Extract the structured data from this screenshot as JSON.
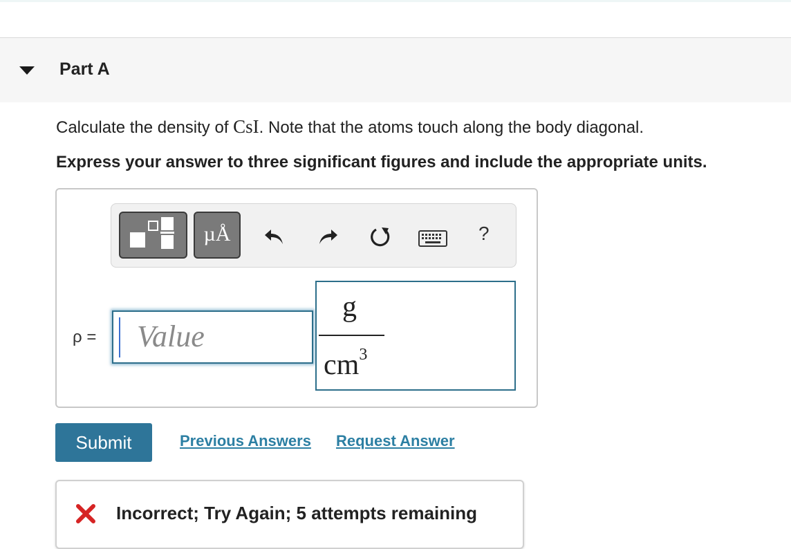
{
  "part": {
    "title": "Part A"
  },
  "question": {
    "prefix": "Calculate the density of ",
    "formula": "CsI",
    "suffix": ". Note that the atoms touch along the body diagonal.",
    "instruction": "Express your answer to three significant figures and include the appropriate units."
  },
  "toolbar": {
    "templates": "templates",
    "units": "µÅ",
    "undo": "undo",
    "redo": "redo",
    "reset": "reset",
    "keyboard": "keyboard",
    "help": "?"
  },
  "answer": {
    "variable_label": "ρ =",
    "value_placeholder": "Value",
    "value": "",
    "unit_numerator": "g",
    "unit_denominator": "cm",
    "unit_exponent": "3"
  },
  "actions": {
    "submit": "Submit",
    "previous_answers": "Previous Answers",
    "request_answer": "Request Answer"
  },
  "feedback": {
    "message": "Incorrect; Try Again; 5 attempts remaining"
  },
  "icons": {
    "collapse": "caret-down-icon",
    "undo": "undo-icon",
    "redo": "redo-icon",
    "reset": "reset-icon",
    "keyboard": "keyboard-icon",
    "help": "help-icon",
    "incorrect": "x-icon"
  },
  "colors": {
    "accent": "#2e7599",
    "link": "#2c7fa3",
    "error": "#d62424",
    "input_border": "#2c6e8a"
  }
}
